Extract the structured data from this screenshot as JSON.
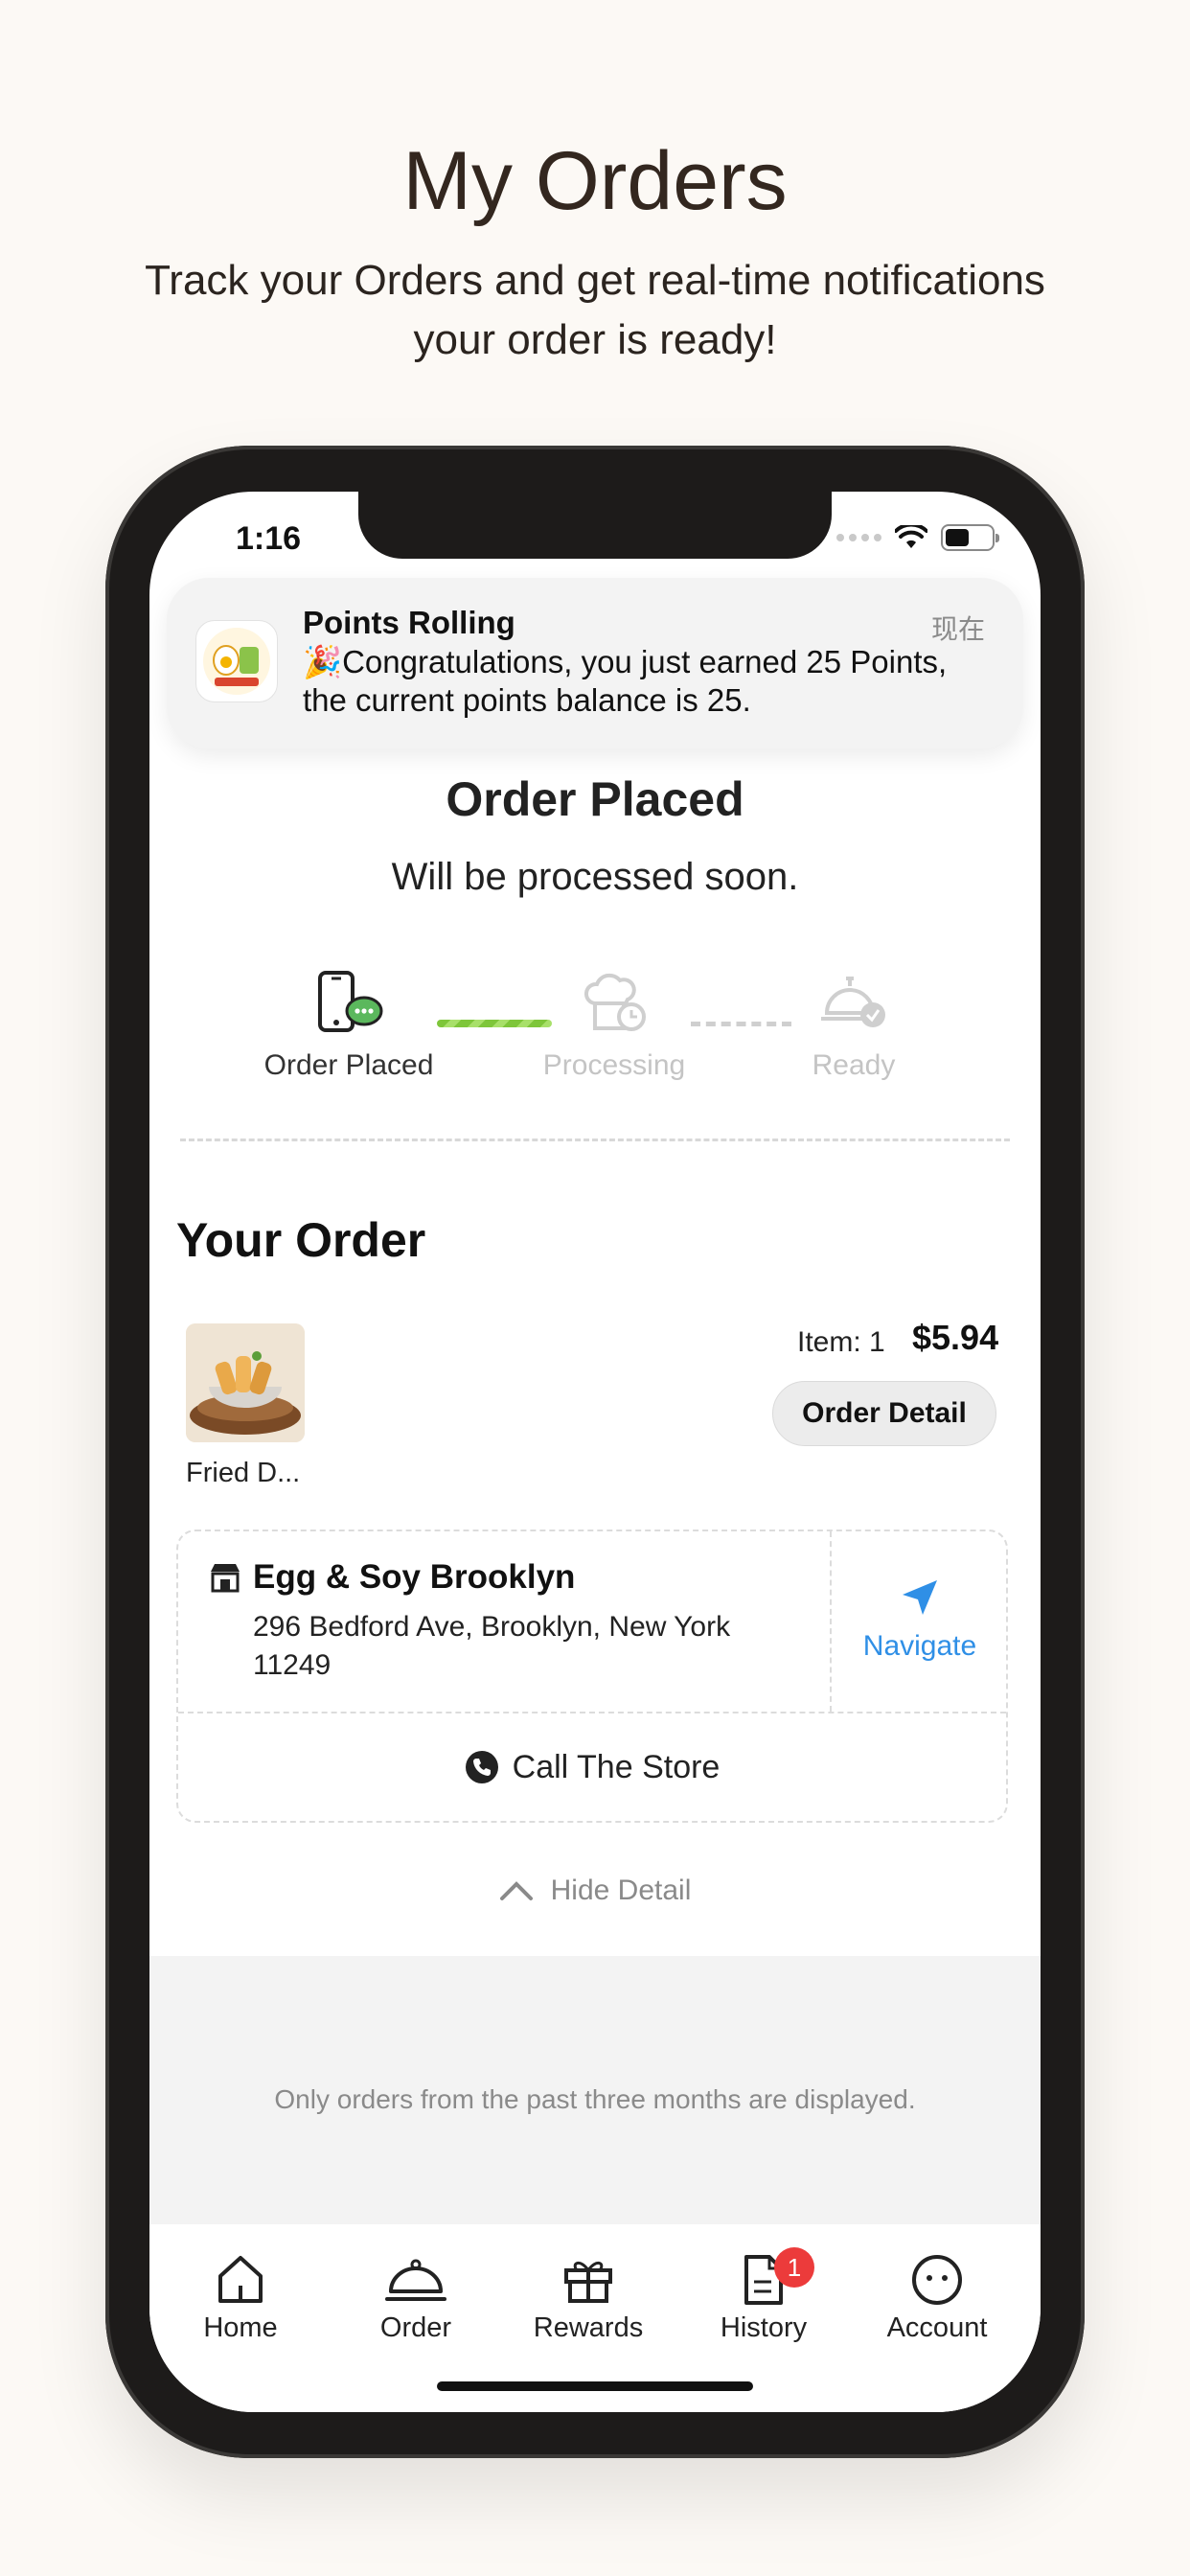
{
  "promo": {
    "headline": "My Orders",
    "subline": "Track your Orders and get real-time notifications your order is ready!"
  },
  "status_bar": {
    "time": "1:16"
  },
  "notification": {
    "title": "Points Rolling",
    "time": "现在",
    "body": "🎉Congratulations, you just earned 25 Points, the current points balance is 25."
  },
  "order_status": {
    "title": "Order Placed",
    "subtitle": "Will be processed soon.",
    "steps": [
      {
        "label": "Order Placed",
        "state": "done"
      },
      {
        "label": "Processing",
        "state": "pending"
      },
      {
        "label": "Ready",
        "state": "pending"
      }
    ]
  },
  "your_order": {
    "heading": "Your Order",
    "item_name": "Fried D...",
    "item_qty": "Item: 1",
    "price": "$5.94",
    "detail_button": "Order Detail"
  },
  "store": {
    "name": "Egg & Soy Brooklyn",
    "address": "296 Bedford Ave, Brooklyn, New York 11249",
    "navigate_label": "Navigate",
    "call_label": "Call The Store",
    "hide_detail_label": "Hide Detail"
  },
  "footer_note": "Only orders from the past three months are displayed.",
  "tabs": [
    {
      "label": "Home",
      "icon": "home-icon"
    },
    {
      "label": "Order",
      "icon": "cloche-icon"
    },
    {
      "label": "Rewards",
      "icon": "gift-icon"
    },
    {
      "label": "History",
      "icon": "receipt-icon",
      "badge": "1"
    },
    {
      "label": "Account",
      "icon": "face-icon"
    }
  ],
  "colors": {
    "background": "#fcf9f5",
    "accent_blue": "#2f8fe6",
    "progress_green": "#7ec63a",
    "badge_red": "#ec3b3b"
  }
}
